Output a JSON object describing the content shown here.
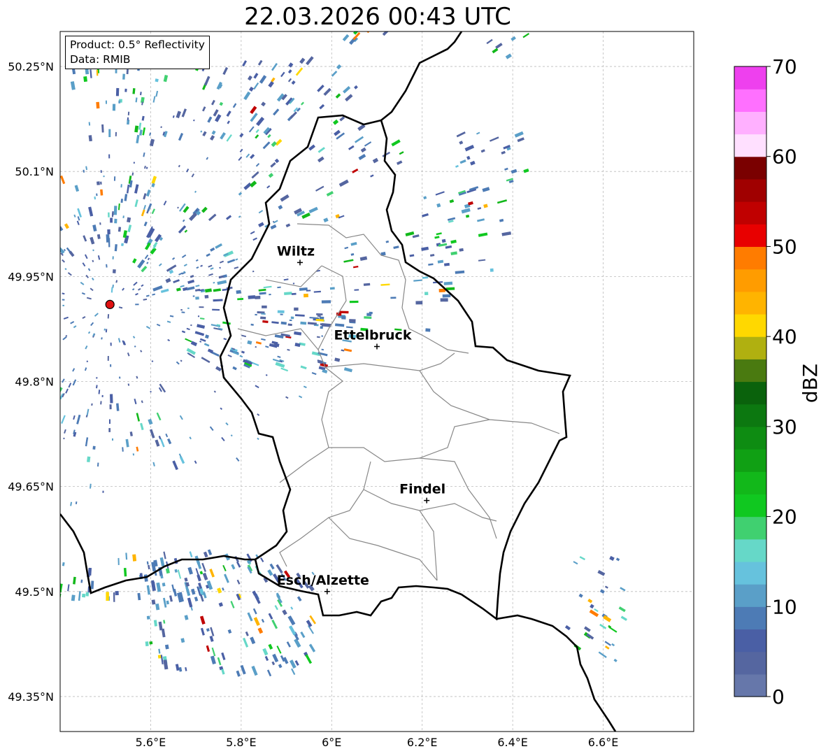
{
  "title": "22.03.2026 00:43 UTC",
  "info_box": {
    "product": "Product: 0.5° Reflectivity",
    "data_source": "Data: RMIB"
  },
  "axes": {
    "x_ticks": [
      {
        "value": 5.6,
        "label": "5.6°E"
      },
      {
        "value": 5.8,
        "label": "5.8°E"
      },
      {
        "value": 6.0,
        "label": "6°E"
      },
      {
        "value": 6.2,
        "label": "6.2°E"
      },
      {
        "value": 6.4,
        "label": "6.4°E"
      },
      {
        "value": 6.6,
        "label": "6.6°E"
      }
    ],
    "y_ticks": [
      {
        "value": 50.25,
        "label": "50.25°N"
      },
      {
        "value": 50.1,
        "label": "50.1°N"
      },
      {
        "value": 49.95,
        "label": "49.95°N"
      },
      {
        "value": 49.8,
        "label": "49.8°N"
      },
      {
        "value": 49.65,
        "label": "49.65°N"
      },
      {
        "value": 49.5,
        "label": "49.5°N"
      },
      {
        "value": 49.35,
        "label": "49.35°N"
      }
    ],
    "lon_range": [
      5.4,
      6.8
    ],
    "lat_range": [
      49.3,
      50.3
    ],
    "grid": true
  },
  "cities": [
    {
      "name": "Wiltz",
      "lon": 5.93,
      "lat": 49.97
    },
    {
      "name": "Ettelbruck",
      "lon": 6.1,
      "lat": 49.85
    },
    {
      "name": "Findel",
      "lon": 6.21,
      "lat": 49.63
    },
    {
      "name": "Esch/Alzette",
      "lon": 5.99,
      "lat": 49.5
    }
  ],
  "radar_site": {
    "lon": 5.51,
    "lat": 49.91,
    "color": "#e01010"
  },
  "colorbar": {
    "label": "dBZ",
    "min": 0,
    "max": 70,
    "tick_values": [
      0,
      10,
      20,
      30,
      40,
      50,
      60,
      70
    ],
    "tick_labels": [
      "0",
      "10",
      "20",
      "30",
      "40",
      "50",
      "60",
      "70"
    ],
    "colors": [
      "#6677aa",
      "#5566a0",
      "#4a5fa5",
      "#4d7bb5",
      "#5a9fc8",
      "#66c2dd",
      "#66d8c8",
      "#40d070",
      "#10c820",
      "#12b81a",
      "#10a014",
      "#0e8c12",
      "#0c7810",
      "#0a620c",
      "#4a7a10",
      "#b0b010",
      "#ffd800",
      "#ffb400",
      "#ff9c00",
      "#ff7c00",
      "#e80000",
      "#c00000",
      "#a00000",
      "#7a0000",
      "#ffe0ff",
      "#ffb0ff",
      "#ff70ff",
      "#ee40ee"
    ]
  }
}
